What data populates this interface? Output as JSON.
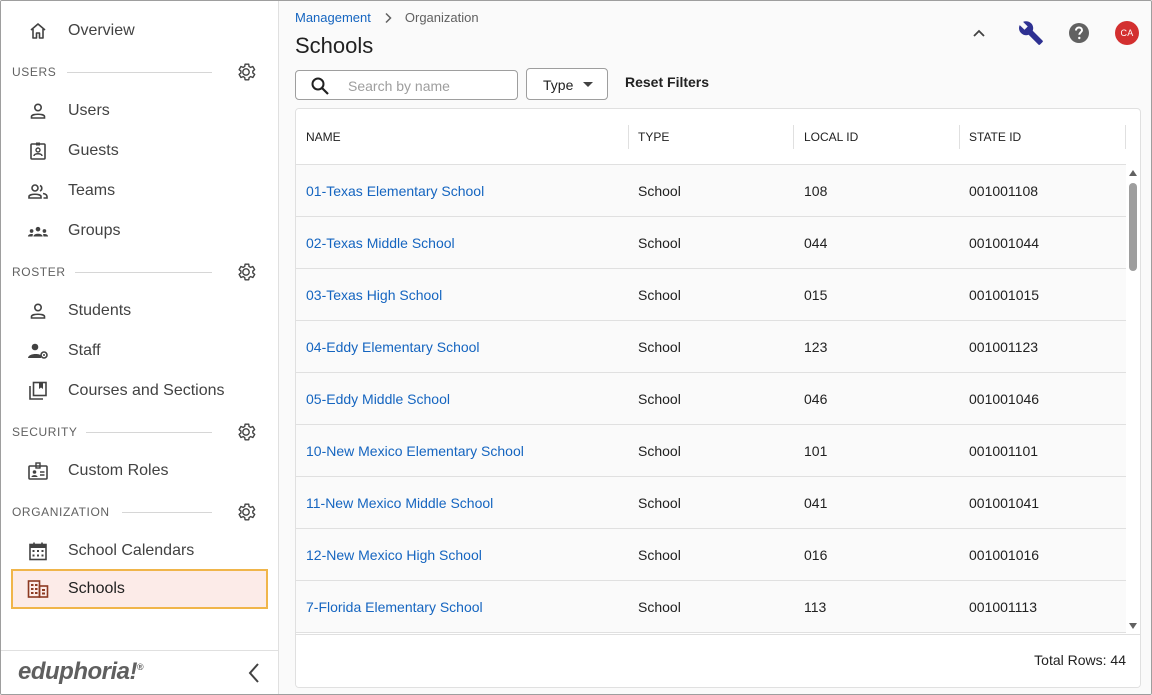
{
  "sidebar": {
    "overview": "Overview",
    "sections": [
      {
        "header": "USERS",
        "items": [
          "Users",
          "Guests",
          "Teams",
          "Groups"
        ]
      },
      {
        "header": "ROSTER",
        "items": [
          "Students",
          "Staff",
          "Courses and Sections"
        ]
      },
      {
        "header": "SECURITY",
        "items": [
          "Custom Roles"
        ]
      },
      {
        "header": "ORGANIZATION",
        "items": [
          "School Calendars",
          "Schools"
        ]
      }
    ],
    "active_item": "Schools",
    "logo": "eduphoria!",
    "logo_mark": "®"
  },
  "breadcrumb": {
    "parent": "Management",
    "current": "Organization"
  },
  "page": {
    "title": "Schools"
  },
  "header_actions": {
    "avatar_initials": "CA"
  },
  "filters": {
    "search_placeholder": "Search by name",
    "search_value": "",
    "type_label": "Type",
    "reset_label": "Reset Filters"
  },
  "table": {
    "columns": [
      "NAME",
      "TYPE",
      "LOCAL ID",
      "STATE ID"
    ],
    "rows": [
      {
        "name": "01-Texas Elementary School",
        "type": "School",
        "local_id": "108",
        "state_id": "001001108"
      },
      {
        "name": "02-Texas Middle School",
        "type": "School",
        "local_id": "044",
        "state_id": "001001044"
      },
      {
        "name": "03-Texas High School",
        "type": "School",
        "local_id": "015",
        "state_id": "001001015"
      },
      {
        "name": "04-Eddy Elementary School",
        "type": "School",
        "local_id": "123",
        "state_id": "001001123"
      },
      {
        "name": "05-Eddy Middle School",
        "type": "School",
        "local_id": "046",
        "state_id": "001001046"
      },
      {
        "name": "10-New Mexico Elementary School",
        "type": "School",
        "local_id": "101",
        "state_id": "001001101"
      },
      {
        "name": "11-New Mexico Middle School",
        "type": "School",
        "local_id": "041",
        "state_id": "001001041"
      },
      {
        "name": "12-New Mexico High School",
        "type": "School",
        "local_id": "016",
        "state_id": "001001016"
      },
      {
        "name": "7-Florida Elementary School",
        "type": "School",
        "local_id": "113",
        "state_id": "001001113"
      }
    ],
    "total_label": "Total Rows: 44"
  },
  "colors": {
    "accent": "#1565c0",
    "active_bg": "#fcebe8",
    "active_border": "#f0b54a",
    "avatar": "#d32f2f"
  }
}
